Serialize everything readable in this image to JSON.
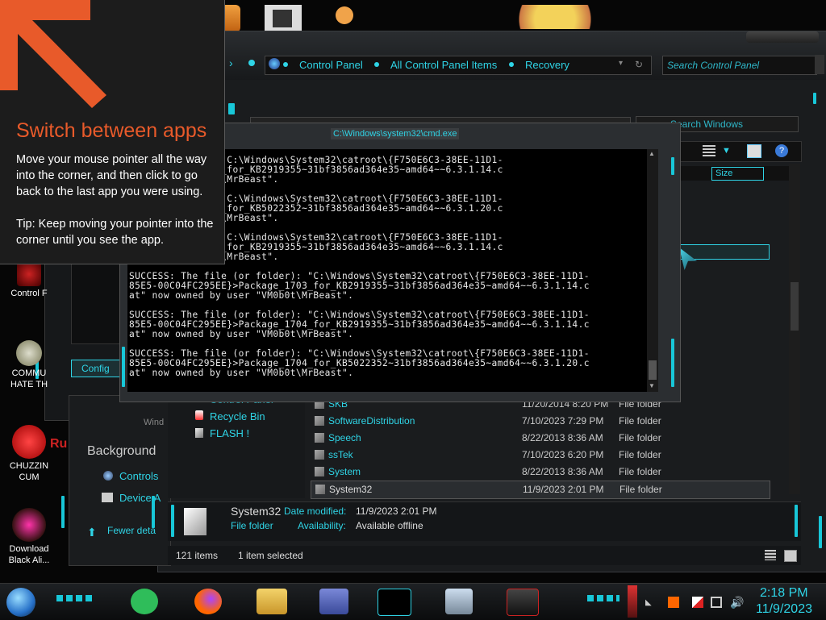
{
  "tip": {
    "title": "Switch between apps",
    "body": "Move your mouse pointer all the way into the corner, and then click to go back to the last app you were using.",
    "tip": "Tip: Keep moving your pointer into the corner until you see the app."
  },
  "desktop_icons": [
    {
      "label": "Control F",
      "icon": "control-panel-icon"
    },
    {
      "label": "COMMU\nHATE TH",
      "icon": "money-bag-icon"
    },
    {
      "label": "CHUZZIN\nCUM",
      "icon": "chuzzle-icon"
    },
    {
      "label": "Download\nBlack Ali...",
      "icon": "alienware-icon"
    }
  ],
  "explorer": {
    "breadcrumb": [
      "Control Panel",
      "All Control Panel Items",
      "Recovery"
    ],
    "search_placeholder": "Search Control Panel",
    "inner_search_placeholder": "Search Windows",
    "size_header": "Size",
    "nav_items": [
      "Control Panel",
      "Recycle Bin",
      "FLASH !"
    ],
    "files": [
      {
        "name": "SKB",
        "date": "11/20/2014 8:20 PM",
        "type": "File folder"
      },
      {
        "name": "SoftwareDistribution",
        "date": "7/10/2023 7:29 PM",
        "type": "File folder"
      },
      {
        "name": "Speech",
        "date": "8/22/2013 8:36 AM",
        "type": "File folder"
      },
      {
        "name": "ssTek",
        "date": "7/10/2023 6:20 PM",
        "type": "File folder"
      },
      {
        "name": "System",
        "date": "8/22/2013 8:36 AM",
        "type": "File folder"
      },
      {
        "name": "System32",
        "date": "11/9/2023 2:01 PM",
        "type": "File folder"
      }
    ],
    "details": {
      "name": "System32",
      "type": "File folder",
      "date_label": "Date modified:",
      "date_value": "11/9/2023 2:01 PM",
      "avail_label": "Availability:",
      "avail_value": "Available offline"
    },
    "status_items": "121 items",
    "status_selected": "1 item selected"
  },
  "back_window": {
    "config_button": "Config",
    "background_label": "Background",
    "links": [
      "Controls",
      "Device A"
    ],
    "fewer": "Fewer deta",
    "win_label": "Wind"
  },
  "cmd": {
    "title": "C:\\Windows\\system32\\cmd.exe",
    "output": "le (or folder): \"C:\\Windows\\System32\\catroot\\{F750E6C3-38EE-11D1-\nEE}>Package_1701_for_KB2919355~31bf3856ad364e35~amd64~~6.3.1.14.c\n by user \"VM0b0t\\MrBeast\".\n\nle (or folder): \"C:\\Windows\\System32\\catroot\\{F750E6C3-38EE-11D1-\nEE}>Package_1701_for_KB5022352~31bf3856ad364e35~amd64~~6.3.1.20.c\n by user \"VM0b0t\\MrBeast\".\n\nle (or folder): \"C:\\Windows\\System32\\catroot\\{F750E6C3-38EE-11D1-\nEE}>Package_1702_for_KB2919355~31bf3856ad364e35~amd64~~6.3.1.14.c\n by user \"VM0b0t\\MrBeast\".\n\nSUCCESS: The file (or folder): \"C:\\Windows\\System32\\catroot\\{F750E6C3-38EE-11D1-\n85E5-00C04FC295EE}>Package_1703_for_KB2919355~31bf3856ad364e35~amd64~~6.3.1.14.c\nat\" now owned by user \"VM0b0t\\MrBeast\".\n\nSUCCESS: The file (or folder): \"C:\\Windows\\System32\\catroot\\{F750E6C3-38EE-11D1-\n85E5-00C04FC295EE}>Package_1704_for_KB2919355~31bf3856ad364e35~amd64~~6.3.1.14.c\nat\" now owned by user \"VM0b0t\\MrBeast\".\n\nSUCCESS: The file (or folder): \"C:\\Windows\\System32\\catroot\\{F750E6C3-38EE-11D1-\n85E5-00C04FC295EE}>Package_1704_for_KB5022352~31bf3856ad364e35~amd64~~6.3.1.20.c\nat\" now owned by user \"VM0b0t\\MrBeast\"."
  },
  "taskbar": {
    "time": "2:18 PM",
    "date": "11/9/2023",
    "apps": [
      "start-orb-icon",
      "notes-app-icon",
      "firefox-icon",
      "file-explorer-icon",
      "control-panel-icon",
      "cmd-icon",
      "monitor-icon",
      "alienware-app-icon"
    ]
  },
  "colors": {
    "accent": "#2fd4e6",
    "tip_accent": "#e85a2a",
    "teal_trim": "#18c7d8"
  }
}
